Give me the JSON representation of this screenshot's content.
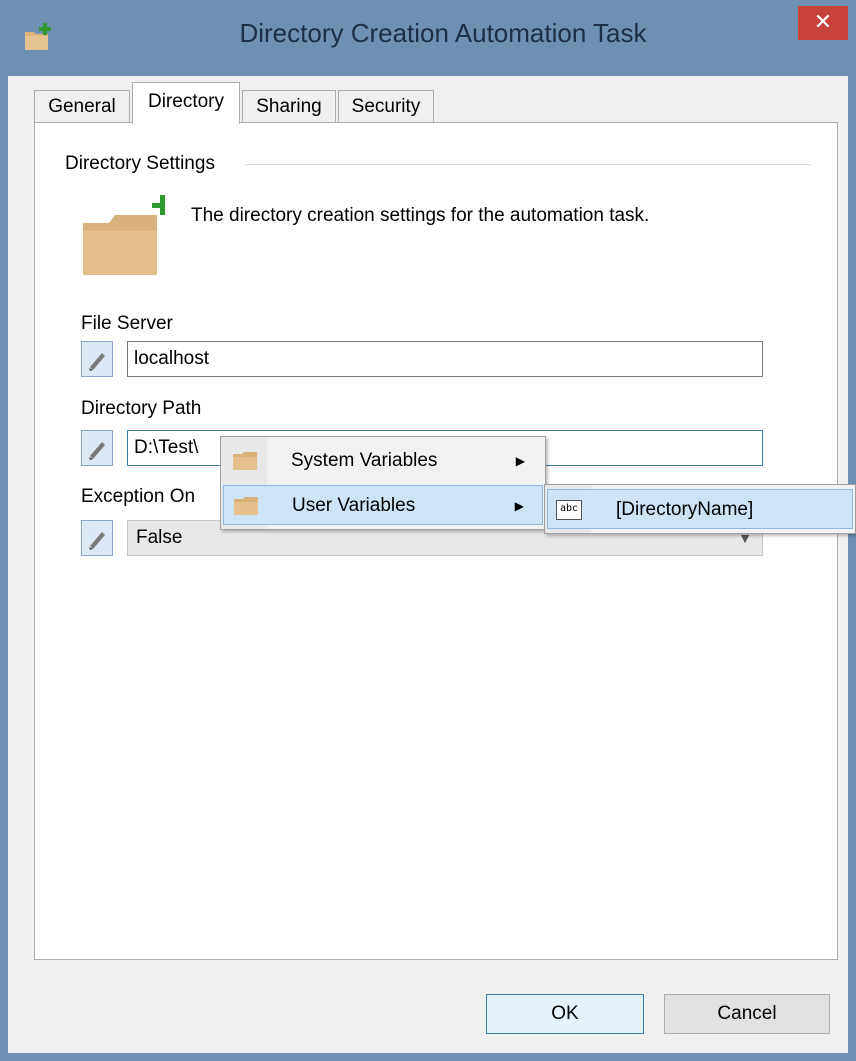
{
  "window": {
    "title": "Directory Creation Automation Task",
    "close_label": "✕"
  },
  "tabs": [
    {
      "label": "General"
    },
    {
      "label": "Directory"
    },
    {
      "label": "Sharing"
    },
    {
      "label": "Security"
    }
  ],
  "active_tab": "Directory",
  "section": {
    "title": "Directory Settings",
    "description": "The directory creation settings for the automation task."
  },
  "fields": {
    "file_server": {
      "label": "File Server",
      "value": "localhost"
    },
    "directory_path": {
      "label": "Directory Path",
      "value": "D:\\Test\\"
    },
    "exception_on": {
      "label": "Exception On",
      "value": "False"
    }
  },
  "context_menu": {
    "items": [
      {
        "label": "System Variables"
      },
      {
        "label": "User Variables"
      }
    ],
    "submenu": {
      "items": [
        {
          "label": "[DirectoryName]",
          "icon_text": "abc"
        }
      ]
    }
  },
  "buttons": {
    "ok": "OK",
    "cancel": "Cancel"
  }
}
